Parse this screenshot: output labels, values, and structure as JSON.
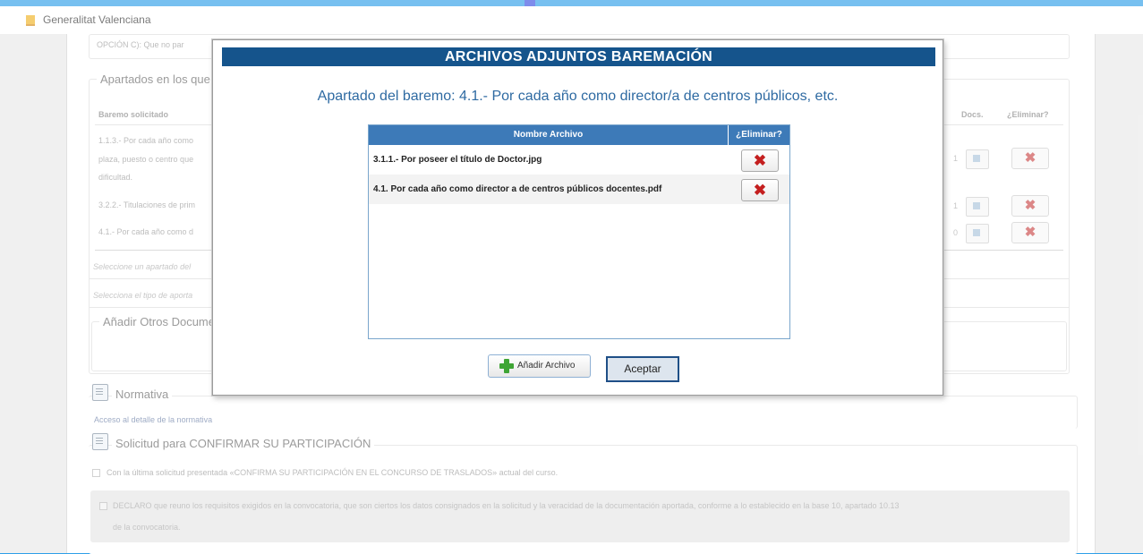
{
  "app": {
    "title": "Generalitat Valenciana"
  },
  "background_form": {
    "option_c": "OPCIÓN C): Que no par",
    "apartados": {
      "legend": "Apartados en los que",
      "col_baremo": "Baremo solicitado",
      "col_docs": "Docs.",
      "col_eliminar": "¿Eliminar?",
      "rows": [
        {
          "text": "1.1.3.- Por cada año como",
          "text2": "plaza, puesto o centro que",
          "text3": "dificultad.",
          "count": "1"
        },
        {
          "text": "3.2.2.- Titulaciones de prim",
          "count": "1"
        },
        {
          "text": "4.1.- Por cada año como d",
          "count": "0"
        }
      ],
      "select_apartado": "Seleccione un apartado del",
      "select_tipo": "Selecciona el tipo de aporta"
    },
    "otros_docs": {
      "legend": "Añadir Otros Docume"
    },
    "normativa": {
      "legend": "Normativa",
      "link": "Acceso al detalle de la normativa"
    },
    "confirmar": {
      "legend": "Solicitud para CONFIRMAR SU PARTICIPACIÓN",
      "check1": "Con la última solicitud presentada «CONFIRMA SU PARTICIPACIÓN EN EL CONCURSO DE TRASLADOS» actual del curso.",
      "declaro_line1": "DECLARO que reuno los requisitos exigidos en la convocatoria, que son ciertos los datos consignados en la solicitud y la veracidad de la documentación aportada, conforme a lo establecido en la base 10, apartado 10.13",
      "declaro_line2": "de la convocatoria."
    }
  },
  "dialog": {
    "title": "ARCHIVOS ADJUNTOS BAREMACIÓN",
    "subtitle": "Apartado del baremo: 4.1.- Por cada año como director/a de centros públicos, etc.",
    "table": {
      "col_name": "Nombre Archivo",
      "col_delete": "¿Eliminar?",
      "files": [
        {
          "name": "3.1.1.- Por poseer el título de Doctor.jpg"
        },
        {
          "name": "4.1. Por cada año como director a de centros públicos docentes.pdf"
        }
      ]
    },
    "add_button": "Añadir Archivo",
    "accept_button": "Aceptar"
  }
}
